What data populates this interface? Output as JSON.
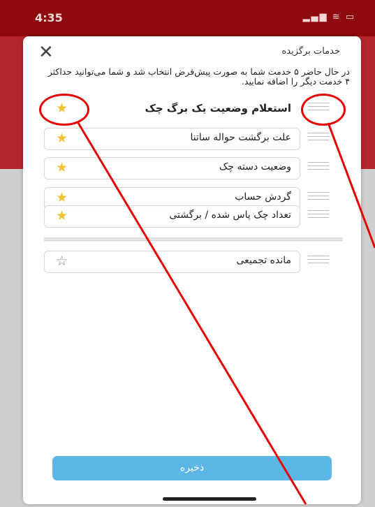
{
  "status_bar": {
    "time": "4:35",
    "indicators": "signal-wifi-battery"
  },
  "dialog": {
    "title": "خدمات برگزیده",
    "description": "در حال حاضر ۵ خدمت شما به صورت پیش‌فرض انتخاب شد و شما می‌توانید حداکثر ۴ خدمت دیگر را اضافه نمایید.",
    "close_icon": "close-icon",
    "save_label": "ذخیره"
  },
  "services": [
    {
      "label": "استعلام وضعیت یک برگ چک",
      "starred": true
    },
    {
      "label": "علت برگشت حواله ساتنا",
      "starred": true
    },
    {
      "label": "وضعیت دسته چک",
      "starred": true
    },
    {
      "label": "گردش حساب",
      "starred": true
    },
    {
      "label": "تعداد چک پاس شده / برگشتی",
      "starred": true
    },
    {
      "label": "مانده تجمیعی",
      "starred": false
    }
  ],
  "colors": {
    "header_red": "#b3262b",
    "star_active": "#f2c230",
    "save_button": "#5cb7e6",
    "annotation_red": "#e80000"
  },
  "icons": {
    "star_on": "★",
    "star_off": "☆",
    "close": "✕"
  }
}
